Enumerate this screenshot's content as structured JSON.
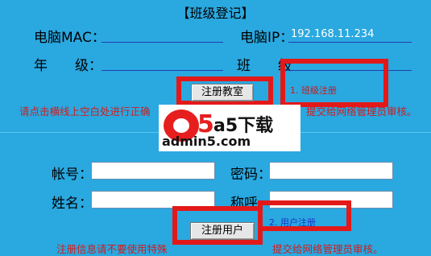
{
  "register_class": {
    "title": "【班级登记】",
    "mac_label": "电脑MAC：",
    "mac_value": "",
    "ip_label": "电脑IP：",
    "ip_value": "192.168.11.234",
    "grade_label": "年　　级：",
    "grade_value": "",
    "class_label": "班　　级",
    "class_value": "",
    "button": "注册教室",
    "warning": "请点击横线上空白处进行正确",
    "warning_tail": "提交给网络管理员审核。",
    "annotation": "1. 班级注册"
  },
  "register_user": {
    "account_label": "帐号：",
    "password_label": "密码：",
    "name_label": "姓名：",
    "nickname_label": "称呼",
    "button": "注册用户",
    "warning_head": "注册信息请不要使用特殊",
    "warning_tail": "提交给网络管理员审核。",
    "annotation": "2. 用户注册"
  },
  "watermark": {
    "logo_text": "a5下载",
    "site": "admin5.com"
  },
  "colors": {
    "background": "#2aa8e0",
    "annotation_box": "#e31919",
    "warning_text": "#d21c1c"
  }
}
